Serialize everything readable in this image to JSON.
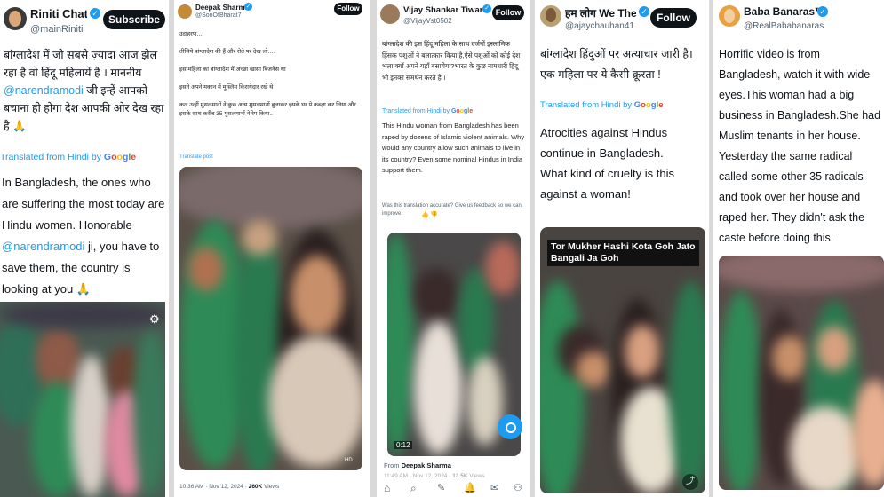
{
  "card1": {
    "name": "Riniti Chatter...",
    "handle": "@mainRiniti",
    "subscribe_label": "Subscribe",
    "hindi_text": "बांग्लादेश में जो सबसे ज़्यादा आज झेल रहा है वो हिंदू महिलायें है । माननीय @narendramodi जी इन्हें आपको बचाना ही होगा देश आपकी ओर देख रहा है 🙏",
    "translated_label": "Translated from Hindi by",
    "google": [
      "G",
      "o",
      "o",
      "g",
      "l",
      "e"
    ],
    "english_text": "In Bangladesh, the ones who are suffering the most today are Hindu women. Honorable @narendramodi ji, you have to save them, the country is looking at you 🙏",
    "gear_icon": "gear-icon"
  },
  "card2": {
    "name": "Deepak Sharma",
    "handle": "@SonOfBharat7",
    "follow_label": "Follow",
    "hindi_text": "उदाहरण…\n\nतीसिये बांग्लादेश की हैं और रोते पर देख लो….\n\nइस महिला का बांग्लादेश में अच्छा खासा बिजनेस था\n\nइसने अपने मकान में मुस्लिम किरायेदार रखे थे\n\nकल उन्हीं मुसलमानों ने कुछ अन्य मुसलमानों बुलाकर इसके घर पे कब्ज़ा कर लिया और इसके साथ करीब 35 मुसलमानों ने रेप किया..",
    "translate_post": "Translate post",
    "time": "10:36 AM · Nov 12, 2024 ·",
    "views": "260K",
    "views_label": "Views",
    "hd_label": "HD"
  },
  "card3": {
    "name": "Vijay Shankar Tiwari",
    "handle": "@VijayVst0502",
    "follow_label": "Follow",
    "hindi_text": "बांग्लादेश की इस हिंदू महिला के साथ दर्जनों इस्लामिक हिंसक पशुओं ने बलात्कार किया है,ऐसे पशुओं को कोई देश भला क्यों अपने यहाँ बसायेगा?भारत के कुछ नामधारी हिंदू भी इनका समर्थन करते है ।",
    "translated_label": "Translated from Hindi by",
    "english_text": "This Hindu woman from Bangladesh has been raped by dozens of Islamic violent animals. Why would any country allow such animals to live in its country? Even some nominal Hindus in India support them.",
    "feedback": "Was this translation accurate? Give us feedback so we can improve:",
    "video_time": "0:12",
    "from_label": "From",
    "from_name": "Deepak Sharma",
    "time": "11:49 AM · Nov 12, 2024 ·",
    "views": "13.5K",
    "views_label": "Views"
  },
  "card4": {
    "name": "हम लोग We The...",
    "handle": "@ajaychauhan41",
    "follow_label": "Follow",
    "hindi_text": "बांग्लादेश हिंदुओं पर अत्याचार जारी है।\nएक महिला पर ये कैसी क्रूरता !",
    "translated_label": "Translated from Hindi by",
    "english_text": "Atrocities against Hindus continue in Bangladesh.\nWhat kind of cruelty is this against a woman!",
    "caption": "Tor Mukher Hashi Kota Goh Jato\nBangali Ja Goh"
  },
  "card5": {
    "name": "Baba Banaras™",
    "handle": "@RealBababanaras",
    "english_text": "Horrific video is from Bangladesh, watch it with wide eyes.This woman had a big business in Bangladesh.She had Muslim tenants in her house. Yesterday the same radical called some other 35 radicals and took over her house and raped her. They didn't ask the caste before doing this."
  },
  "colors": {
    "link": "#1d9bf0",
    "muted": "#536471",
    "uniform_green": "#2e8b57"
  }
}
